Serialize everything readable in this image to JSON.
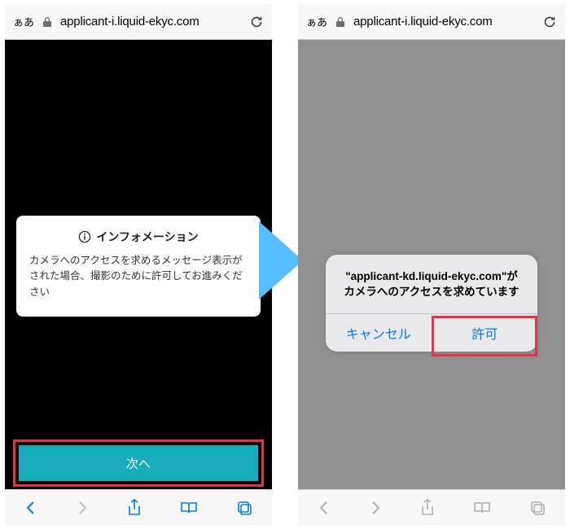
{
  "left": {
    "topbar": {
      "aa": "ぁあ",
      "url": "applicant-i.liquid-ekyc.com"
    },
    "card": {
      "title": "インフォメーション",
      "body": "カメラへのアクセスを求めるメッセージ表示がされた場合、撮影のために許可してお進みください"
    },
    "next_label": "次へ"
  },
  "right": {
    "topbar": {
      "aa": "ぁあ",
      "url": "applicant-i.liquid-ekyc.com"
    },
    "alert": {
      "message": "\"applicant-kd.liquid-ekyc.com\"がカメラへのアクセスを求めています",
      "cancel": "キャンセル",
      "allow": "許可"
    }
  }
}
